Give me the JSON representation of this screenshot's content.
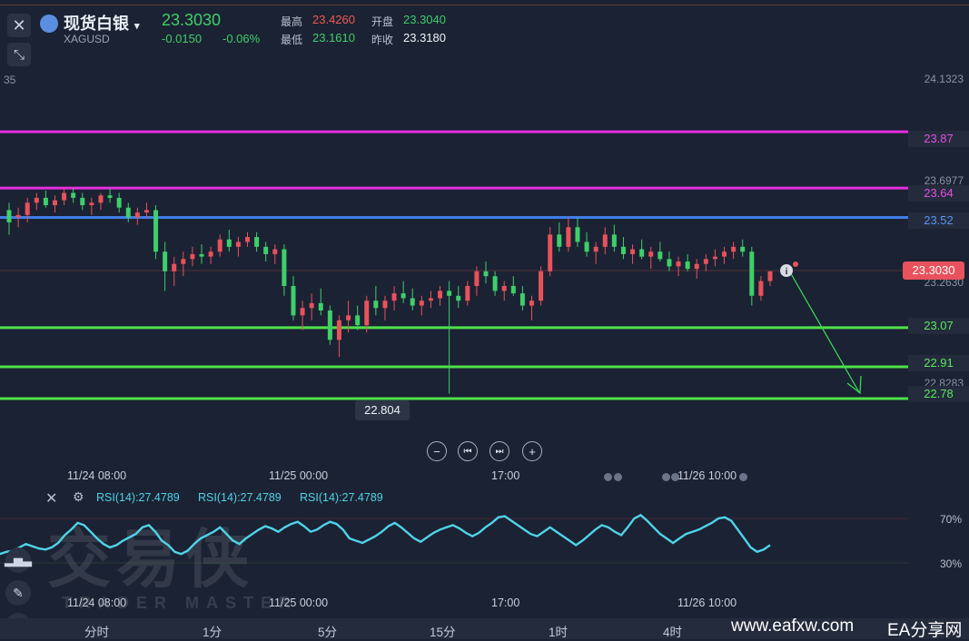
{
  "header": {
    "title": "现货白银",
    "title_caret": "▾",
    "symbol": "XAGUSD",
    "price": "23.3030",
    "change": "-0.0150",
    "change_pct": "-0.06%",
    "high_label": "最高",
    "high_value": "23.4260",
    "open_label": "开盘",
    "open_value": "23.3040",
    "low_label": "最低",
    "low_value": "23.1610",
    "prev_close_label": "昨收",
    "prev_close_value": "23.3180",
    "corner_fragment": "35"
  },
  "axis": {
    "labels": [
      "24.1323",
      "23.6977",
      "23.2630",
      "22.8283"
    ]
  },
  "levels": [
    {
      "label": "23.87",
      "color": "#e62ee0"
    },
    {
      "label": "23.64",
      "color": "#e62ee0"
    },
    {
      "label": "23.52",
      "color": "#3f7ee8"
    },
    {
      "label": "23.07",
      "color": "#4fe04a"
    },
    {
      "label": "22.91",
      "color": "#4fe04a"
    },
    {
      "label": "22.78",
      "color": "#4fe04a"
    }
  ],
  "current_price_tag": "23.3030",
  "low_marker": "22.804",
  "chart_data": {
    "type": "candlestick",
    "candles": [
      [
        23.55,
        23.58,
        23.45,
        23.5
      ],
      [
        23.52,
        23.56,
        23.48,
        23.53
      ],
      [
        23.53,
        23.6,
        23.5,
        23.58
      ],
      [
        23.58,
        23.62,
        23.55,
        23.6
      ],
      [
        23.6,
        23.63,
        23.56,
        23.57
      ],
      [
        23.57,
        23.61,
        23.54,
        23.59
      ],
      [
        23.59,
        23.64,
        23.57,
        23.62
      ],
      [
        23.62,
        23.64,
        23.58,
        23.6
      ],
      [
        23.6,
        23.62,
        23.55,
        23.57
      ],
      [
        23.57,
        23.6,
        23.53,
        23.58
      ],
      [
        23.58,
        23.62,
        23.55,
        23.61
      ],
      [
        23.61,
        23.64,
        23.58,
        23.6
      ],
      [
        23.6,
        23.62,
        23.54,
        23.56
      ],
      [
        23.56,
        23.58,
        23.5,
        23.52
      ],
      [
        23.52,
        23.56,
        23.49,
        23.54
      ],
      [
        23.54,
        23.58,
        23.52,
        23.55
      ],
      [
        23.55,
        23.57,
        23.35,
        23.38
      ],
      [
        23.38,
        23.42,
        23.22,
        23.3
      ],
      [
        23.3,
        23.36,
        23.24,
        23.33
      ],
      [
        23.33,
        23.38,
        23.28,
        23.35
      ],
      [
        23.35,
        23.4,
        23.32,
        23.37
      ],
      [
        23.37,
        23.41,
        23.33,
        23.36
      ],
      [
        23.36,
        23.4,
        23.33,
        23.38
      ],
      [
        23.38,
        23.45,
        23.36,
        23.43
      ],
      [
        23.43,
        23.47,
        23.38,
        23.4
      ],
      [
        23.4,
        23.44,
        23.36,
        23.42
      ],
      [
        23.42,
        23.46,
        23.4,
        23.44
      ],
      [
        23.44,
        23.46,
        23.38,
        23.4
      ],
      [
        23.4,
        23.42,
        23.34,
        23.37
      ],
      [
        23.37,
        23.41,
        23.33,
        23.39
      ],
      [
        23.39,
        23.41,
        23.2,
        23.24
      ],
      [
        23.24,
        23.28,
        23.1,
        23.12
      ],
      [
        23.12,
        23.18,
        23.06,
        23.15
      ],
      [
        23.15,
        23.21,
        23.1,
        23.17
      ],
      [
        23.17,
        23.23,
        23.12,
        23.14
      ],
      [
        23.14,
        23.16,
        23.0,
        23.02
      ],
      [
        23.02,
        23.12,
        22.95,
        23.1
      ],
      [
        23.1,
        23.18,
        23.05,
        23.12
      ],
      [
        23.12,
        23.16,
        23.06,
        23.08
      ],
      [
        23.08,
        23.2,
        23.05,
        23.18
      ],
      [
        23.18,
        23.24,
        23.12,
        23.15
      ],
      [
        23.15,
        23.2,
        23.1,
        23.18
      ],
      [
        23.18,
        23.24,
        23.14,
        23.21
      ],
      [
        23.21,
        23.26,
        23.17,
        23.19
      ],
      [
        23.19,
        23.23,
        23.14,
        23.16
      ],
      [
        23.16,
        23.2,
        23.12,
        23.18
      ],
      [
        23.18,
        23.22,
        23.15,
        23.19
      ],
      [
        23.19,
        23.24,
        23.16,
        23.22
      ],
      [
        23.22,
        23.26,
        22.8,
        23.2
      ],
      [
        23.2,
        23.24,
        23.15,
        23.18
      ],
      [
        23.18,
        23.26,
        23.16,
        23.24
      ],
      [
        23.24,
        23.32,
        23.2,
        23.3
      ],
      [
        23.3,
        23.34,
        23.25,
        23.28
      ],
      [
        23.28,
        23.3,
        23.2,
        23.22
      ],
      [
        23.22,
        23.26,
        23.18,
        23.24
      ],
      [
        23.24,
        23.28,
        23.2,
        23.21
      ],
      [
        23.21,
        23.24,
        23.14,
        23.16
      ],
      [
        23.16,
        23.2,
        23.1,
        23.18
      ],
      [
        23.18,
        23.32,
        23.16,
        23.3
      ],
      [
        23.3,
        23.48,
        23.28,
        23.45
      ],
      [
        23.45,
        23.5,
        23.38,
        23.4
      ],
      [
        23.4,
        23.52,
        23.38,
        23.48
      ],
      [
        23.48,
        23.52,
        23.4,
        23.42
      ],
      [
        23.42,
        23.46,
        23.36,
        23.38
      ],
      [
        23.38,
        23.42,
        23.33,
        23.4
      ],
      [
        23.4,
        23.48,
        23.37,
        23.45
      ],
      [
        23.45,
        23.49,
        23.38,
        23.4
      ],
      [
        23.4,
        23.44,
        23.35,
        23.37
      ],
      [
        23.37,
        23.41,
        23.33,
        23.39
      ],
      [
        23.39,
        23.43,
        23.35,
        23.36
      ],
      [
        23.36,
        23.4,
        23.31,
        23.38
      ],
      [
        23.38,
        23.42,
        23.34,
        23.35
      ],
      [
        23.35,
        23.38,
        23.3,
        23.32
      ],
      [
        23.32,
        23.36,
        23.28,
        23.34
      ],
      [
        23.34,
        23.37,
        23.3,
        23.31
      ],
      [
        23.31,
        23.35,
        23.27,
        23.33
      ],
      [
        23.33,
        23.37,
        23.3,
        23.35
      ],
      [
        23.35,
        23.39,
        23.32,
        23.36
      ],
      [
        23.36,
        23.4,
        23.33,
        23.38
      ],
      [
        23.38,
        23.42,
        23.35,
        23.4
      ],
      [
        23.4,
        23.43,
        23.36,
        23.38
      ],
      [
        23.38,
        23.4,
        23.16,
        23.2
      ],
      [
        23.2,
        23.28,
        23.18,
        23.26
      ],
      [
        23.26,
        23.3,
        23.24,
        23.3
      ]
    ]
  },
  "time_labels": [
    "11/24 08:00",
    "11/25 00:00",
    "17:00",
    "11/26 10:00"
  ],
  "rsi": {
    "label1": "RSI(14):27.4789",
    "label2": "RSI(14):27.4789",
    "label3": "RSI(14):27.4789",
    "level_high": "70%",
    "level_low": "30%",
    "values": [
      38,
      40,
      41,
      44,
      47,
      45,
      43,
      42,
      44,
      48,
      55,
      60,
      66,
      64,
      58,
      52,
      47,
      44,
      46,
      50,
      53,
      56,
      62,
      64,
      58,
      50,
      46,
      40,
      38,
      41,
      47,
      52,
      55,
      58,
      62,
      56,
      50,
      47,
      52,
      56,
      60,
      63,
      61,
      58,
      62,
      65,
      67,
      63,
      58,
      60,
      64,
      67,
      65,
      60,
      52,
      50,
      48,
      51,
      54,
      58,
      63,
      66,
      62,
      57,
      52,
      49,
      53,
      57,
      60,
      62,
      64,
      61,
      57,
      54,
      57,
      62,
      66,
      71,
      72,
      68,
      64,
      60,
      56,
      54,
      58,
      62,
      58,
      54,
      50,
      46,
      50,
      55,
      60,
      64,
      62,
      58,
      55,
      62,
      70,
      73,
      68,
      62,
      56,
      52,
      48,
      52,
      56,
      58,
      60,
      63,
      66,
      70,
      71,
      68,
      60,
      52,
      44,
      40,
      42,
      46
    ]
  },
  "tabs": [
    "分时",
    "1分",
    "5分",
    "15分",
    "1时",
    "4时"
  ],
  "watermark": "交易侠",
  "watermark_sub": "TRADER MASTER",
  "site_text": "www.eafxw.com",
  "site_text2": "EA分享网",
  "colors": {
    "up": "#e8525c",
    "down": "#3ecf6a",
    "rsi": "#4fd3e8",
    "arrow": "#3ee05a"
  }
}
